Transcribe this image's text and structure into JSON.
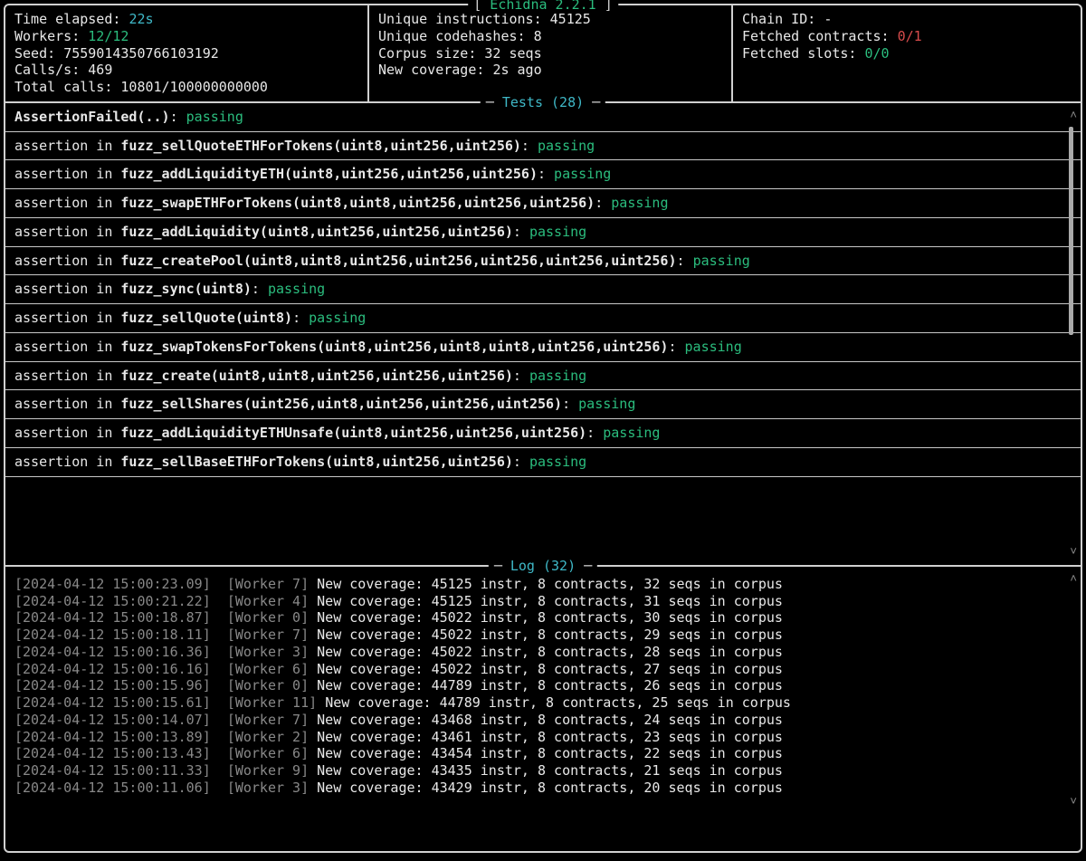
{
  "app_title": "Echidna 2.2.1",
  "stats_left": {
    "time_elapsed_label": "Time elapsed:",
    "time_elapsed": "22s",
    "workers_label": "Workers:",
    "workers": "12/12",
    "seed_label": "Seed:",
    "seed": "7559014350766103192",
    "calls_per_s_label": "Calls/s:",
    "calls_per_s": "469",
    "total_calls_label": "Total calls:",
    "total_calls": "10801/100000000000"
  },
  "stats_mid": {
    "uniq_instr_label": "Unique instructions:",
    "uniq_instr": "45125",
    "uniq_hash_label": "Unique codehashes:",
    "uniq_hash": "8",
    "corpus_label": "Corpus size:",
    "corpus": "32 seqs",
    "coverage_label": "New coverage:",
    "coverage": "2s ago"
  },
  "stats_right": {
    "chain_label": "Chain ID:",
    "chain": "-",
    "contracts_label": "Fetched contracts:",
    "contracts": "0/1",
    "slots_label": "Fetched slots:",
    "slots": "0/0"
  },
  "tests_header": "Tests (28)",
  "tests": [
    {
      "prefix": "",
      "name": "AssertionFailed(..)",
      "status": "passing"
    },
    {
      "prefix": "assertion in ",
      "name": "fuzz_sellQuoteETHForTokens(uint8,uint256,uint256)",
      "status": "passing"
    },
    {
      "prefix": "assertion in ",
      "name": "fuzz_addLiquidityETH(uint8,uint256,uint256,uint256)",
      "status": "passing"
    },
    {
      "prefix": "assertion in ",
      "name": "fuzz_swapETHForTokens(uint8,uint8,uint256,uint256,uint256)",
      "status": "passing"
    },
    {
      "prefix": "assertion in ",
      "name": "fuzz_addLiquidity(uint8,uint256,uint256,uint256)",
      "status": "passing"
    },
    {
      "prefix": "assertion in ",
      "name": "fuzz_createPool(uint8,uint8,uint256,uint256,uint256,uint256,uint256)",
      "status": "passing"
    },
    {
      "prefix": "assertion in ",
      "name": "fuzz_sync(uint8)",
      "status": "passing"
    },
    {
      "prefix": "assertion in ",
      "name": "fuzz_sellQuote(uint8)",
      "status": "passing"
    },
    {
      "prefix": "assertion in ",
      "name": "fuzz_swapTokensForTokens(uint8,uint256,uint8,uint8,uint256,uint256)",
      "status": "passing"
    },
    {
      "prefix": "assertion in ",
      "name": "fuzz_create(uint8,uint8,uint256,uint256,uint256)",
      "status": "passing"
    },
    {
      "prefix": "assertion in ",
      "name": "fuzz_sellShares(uint256,uint8,uint256,uint256,uint256)",
      "status": "passing"
    },
    {
      "prefix": "assertion in ",
      "name": "fuzz_addLiquidityETHUnsafe(uint8,uint256,uint256,uint256)",
      "status": "passing"
    },
    {
      "prefix": "assertion in ",
      "name": "fuzz_sellBaseETHForTokens(uint8,uint256,uint256)",
      "status": "passing"
    }
  ],
  "log_header": "Log (32)",
  "log": [
    {
      "ts": "[2024-04-12 15:00:23.09]",
      "worker": "[Worker 7]",
      "msg": "New coverage: 45125 instr, 8 contracts, 32 seqs in corpus"
    },
    {
      "ts": "[2024-04-12 15:00:21.22]",
      "worker": "[Worker 4]",
      "msg": "New coverage: 45125 instr, 8 contracts, 31 seqs in corpus"
    },
    {
      "ts": "[2024-04-12 15:00:18.87]",
      "worker": "[Worker 0]",
      "msg": "New coverage: 45022 instr, 8 contracts, 30 seqs in corpus"
    },
    {
      "ts": "[2024-04-12 15:00:18.11]",
      "worker": "[Worker 7]",
      "msg": "New coverage: 45022 instr, 8 contracts, 29 seqs in corpus"
    },
    {
      "ts": "[2024-04-12 15:00:16.36]",
      "worker": "[Worker 3]",
      "msg": "New coverage: 45022 instr, 8 contracts, 28 seqs in corpus"
    },
    {
      "ts": "[2024-04-12 15:00:16.16]",
      "worker": "[Worker 6]",
      "msg": "New coverage: 45022 instr, 8 contracts, 27 seqs in corpus"
    },
    {
      "ts": "[2024-04-12 15:00:15.96]",
      "worker": "[Worker 0]",
      "msg": "New coverage: 44789 instr, 8 contracts, 26 seqs in corpus"
    },
    {
      "ts": "[2024-04-12 15:00:15.61]",
      "worker": "[Worker 11]",
      "msg": "New coverage: 44789 instr, 8 contracts, 25 seqs in corpus"
    },
    {
      "ts": "[2024-04-12 15:00:14.07]",
      "worker": "[Worker 7]",
      "msg": "New coverage: 43468 instr, 8 contracts, 24 seqs in corpus"
    },
    {
      "ts": "[2024-04-12 15:00:13.89]",
      "worker": "[Worker 2]",
      "msg": "New coverage: 43461 instr, 8 contracts, 23 seqs in corpus"
    },
    {
      "ts": "[2024-04-12 15:00:13.43]",
      "worker": "[Worker 6]",
      "msg": "New coverage: 43454 instr, 8 contracts, 22 seqs in corpus"
    },
    {
      "ts": "[2024-04-12 15:00:11.33]",
      "worker": "[Worker 9]",
      "msg": "New coverage: 43435 instr, 8 contracts, 21 seqs in corpus"
    },
    {
      "ts": "[2024-04-12 15:00:11.06]",
      "worker": "[Worker 3]",
      "msg": "New coverage: 43429 instr, 8 contracts, 20 seqs in corpus"
    }
  ]
}
